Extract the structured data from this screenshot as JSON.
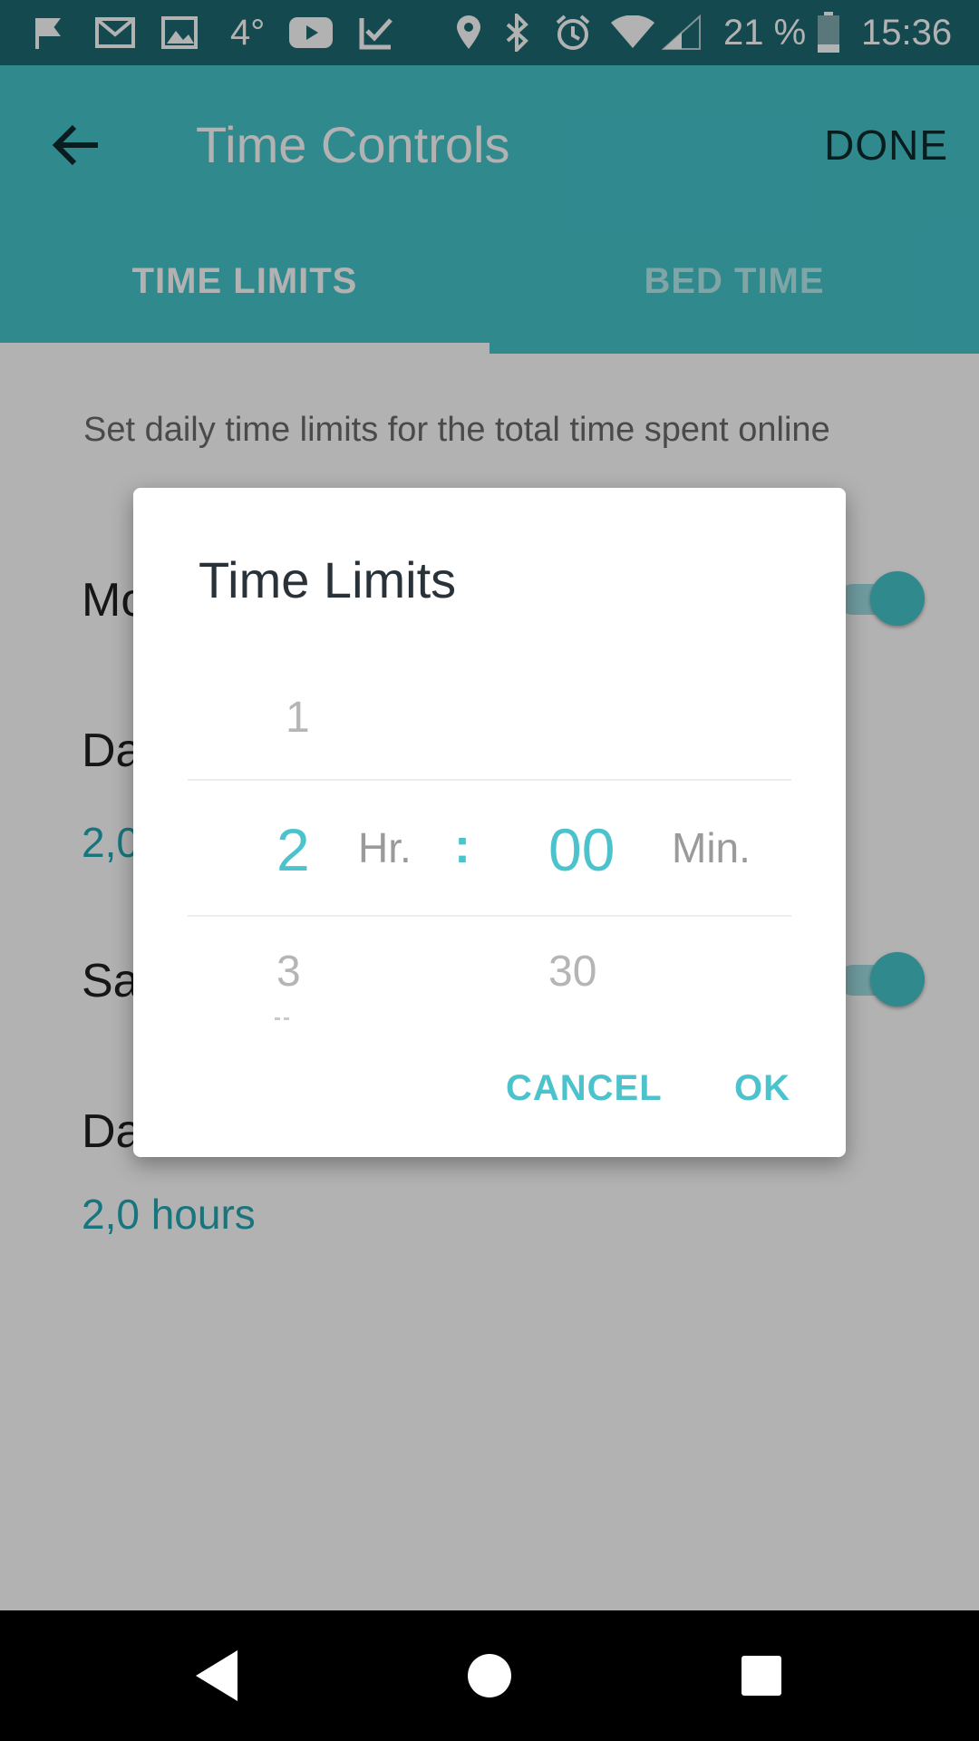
{
  "status_bar": {
    "temperature": "4°",
    "battery_percent": "21 %",
    "time": "15:36",
    "icons": [
      "flag-icon",
      "gmail-icon",
      "image-icon",
      "youtube-icon",
      "check-icon",
      "location-icon",
      "bluetooth-icon",
      "alarm-icon",
      "wifi-icon",
      "signal-icon",
      "battery-icon"
    ]
  },
  "app_bar": {
    "title": "Time Controls",
    "done_label": "DONE",
    "tabs": [
      {
        "label": "TIME LIMITS",
        "active": true
      },
      {
        "label": "BED TIME",
        "active": false
      }
    ]
  },
  "content": {
    "description": "Set daily time limits for the total time spent online",
    "rows": [
      {
        "label": "Mo",
        "toggle_on": true
      },
      {
        "label": "Da",
        "value": "2,0"
      },
      {
        "label": "Sa",
        "toggle_on": true
      },
      {
        "label": "Da",
        "value": "2,0 hours"
      }
    ]
  },
  "dialog": {
    "title": "Time Limits",
    "hours": {
      "prev": "1",
      "selected": "2",
      "next": "3",
      "unit": "Hr."
    },
    "separator": ":",
    "minutes": {
      "selected": "00",
      "next": "30",
      "unit": "Min."
    },
    "cancel_label": "CANCEL",
    "ok_label": "OK"
  },
  "colors": {
    "accent": "#44c4cb",
    "status_bar": "#1d6a72",
    "dialog_accent": "#4cc3cc"
  }
}
